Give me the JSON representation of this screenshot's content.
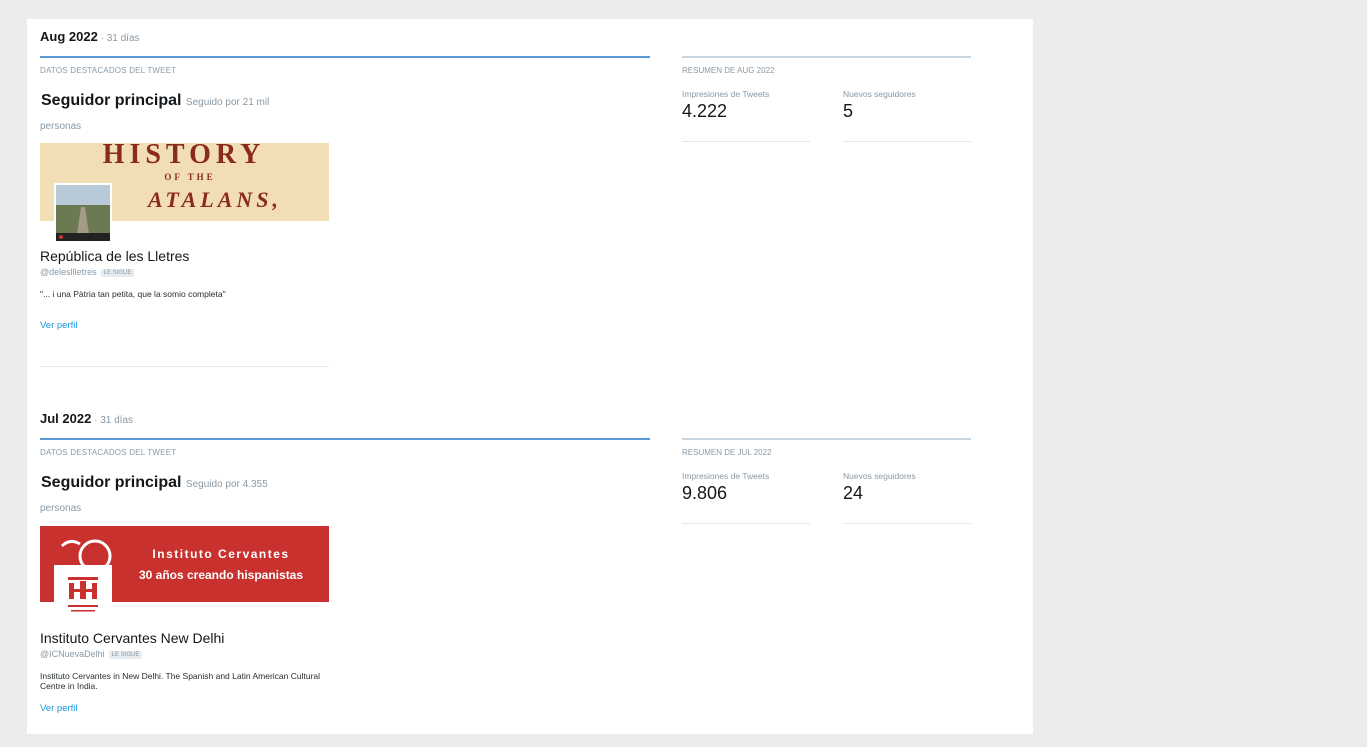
{
  "months": [
    {
      "title": "Aug 2022",
      "days": " · 31 días",
      "highlights_label": "DATOS DESTACADOS DEL TWEET",
      "top_follower_label": "Seguidor principal",
      "followed_by": "Seguido por 21 mil",
      "persons": "personas",
      "account": {
        "name": "República de les Lletres",
        "handle": "@delesllletres",
        "follows_badge": "LE SIGUE",
        "bio": "\"... i una Pàtria tan petita, que la somio completa\"",
        "banner_lines": [
          "HISTORY",
          "OF THE",
          "ATALANS,"
        ]
      },
      "view_profile": "Ver perfil",
      "summary_label": "RESUMEN DE AUG 2022",
      "impressions_label": "Impresiones de Tweets",
      "impressions": "4.222",
      "new_followers_label": "Nuevos seguidores",
      "new_followers": "5"
    },
    {
      "title": "Jul 2022",
      "days": " · 31 días",
      "highlights_label": "DATOS DESTACADOS DEL TWEET",
      "top_follower_label": "Seguidor principal",
      "followed_by": "Seguido por 4.355",
      "persons": "personas",
      "account": {
        "name": "Instituto Cervantes New Delhi",
        "handle": "@ICNuevaDelhi",
        "follows_badge": "LE SIGUE",
        "bio": "Instituto Cervantes in New Delhi. The Spanish and Latin American Cultural Centre in India.",
        "banner_lines": [
          "Instituto Cervantes",
          "30 años creando hispanistas"
        ]
      },
      "view_profile": "Ver perfil",
      "summary_label": "RESUMEN DE JUL 2022",
      "impressions_label": "Impresiones de Tweets",
      "impressions": "9.806",
      "new_followers_label": "Nuevos seguidores",
      "new_followers": "24"
    }
  ],
  "colors": {
    "accent_blue": "#5b9bd5",
    "link_blue": "#1b95e0",
    "cervantes_red": "#c8312e",
    "history_banner": "#f2deb4",
    "history_text": "#8b2a1f"
  }
}
